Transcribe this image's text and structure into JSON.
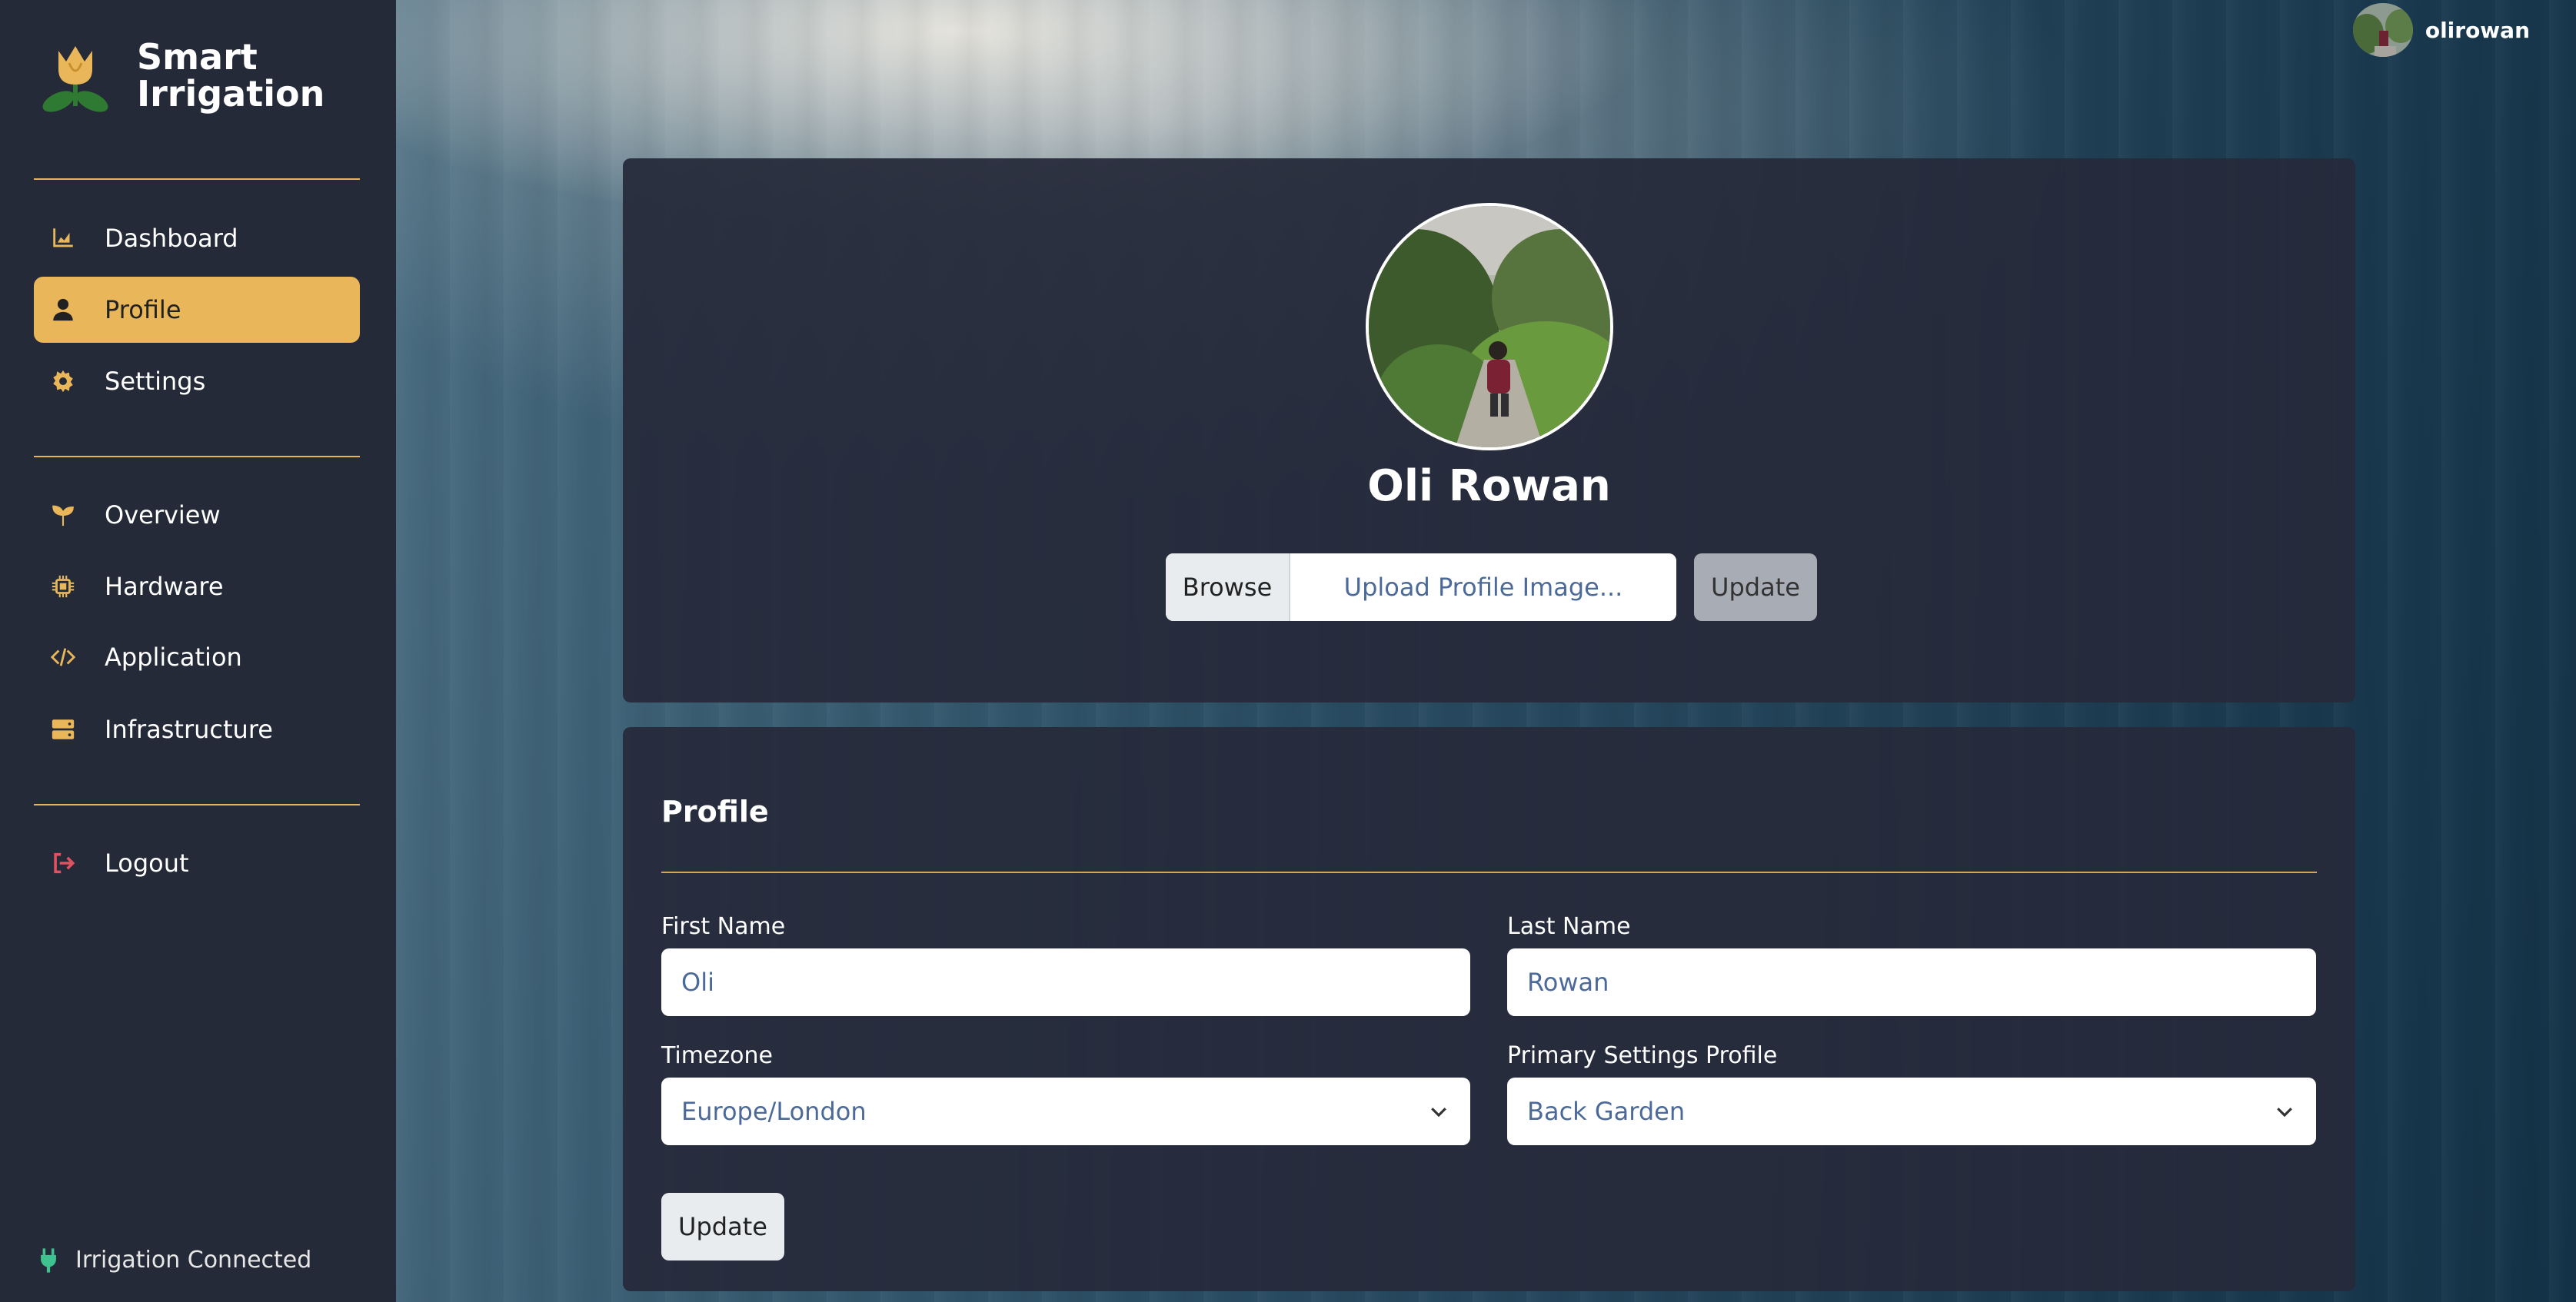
{
  "app": {
    "name": "Smart Irrigation"
  },
  "user": {
    "username": "olirowan",
    "full_name": "Oli Rowan"
  },
  "sidebar": {
    "primary": [
      {
        "label": "Dashboard",
        "icon": "chart-area-icon"
      },
      {
        "label": "Profile",
        "icon": "user-icon",
        "active": true
      },
      {
        "label": "Settings",
        "icon": "gear-icon"
      }
    ],
    "secondary": [
      {
        "label": "Overview",
        "icon": "seedling-icon"
      },
      {
        "label": "Hardware",
        "icon": "microchip-icon"
      },
      {
        "label": "Application",
        "icon": "code-icon"
      },
      {
        "label": "Infrastructure",
        "icon": "server-icon"
      }
    ],
    "logout": {
      "label": "Logout",
      "icon": "logout-icon"
    },
    "status": {
      "label": "Irrigation Connected",
      "icon": "plug-icon"
    }
  },
  "image_upload": {
    "browse_label": "Browse",
    "placeholder": "Upload Profile Image...",
    "update_label": "Update"
  },
  "profile_form": {
    "title": "Profile",
    "first_name": {
      "label": "First Name",
      "value": "Oli"
    },
    "last_name": {
      "label": "Last Name",
      "value": "Rowan"
    },
    "timezone": {
      "label": "Timezone",
      "value": "Europe/London"
    },
    "settings_profile": {
      "label": "Primary Settings Profile",
      "value": "Back Garden"
    },
    "update_label": "Update"
  },
  "colors": {
    "accent": "#e9b659",
    "sidebar_bg": "#252a38",
    "card_bg": "#262b3a",
    "logout_icon": "#e05260",
    "status_icon": "#3ec28f"
  }
}
